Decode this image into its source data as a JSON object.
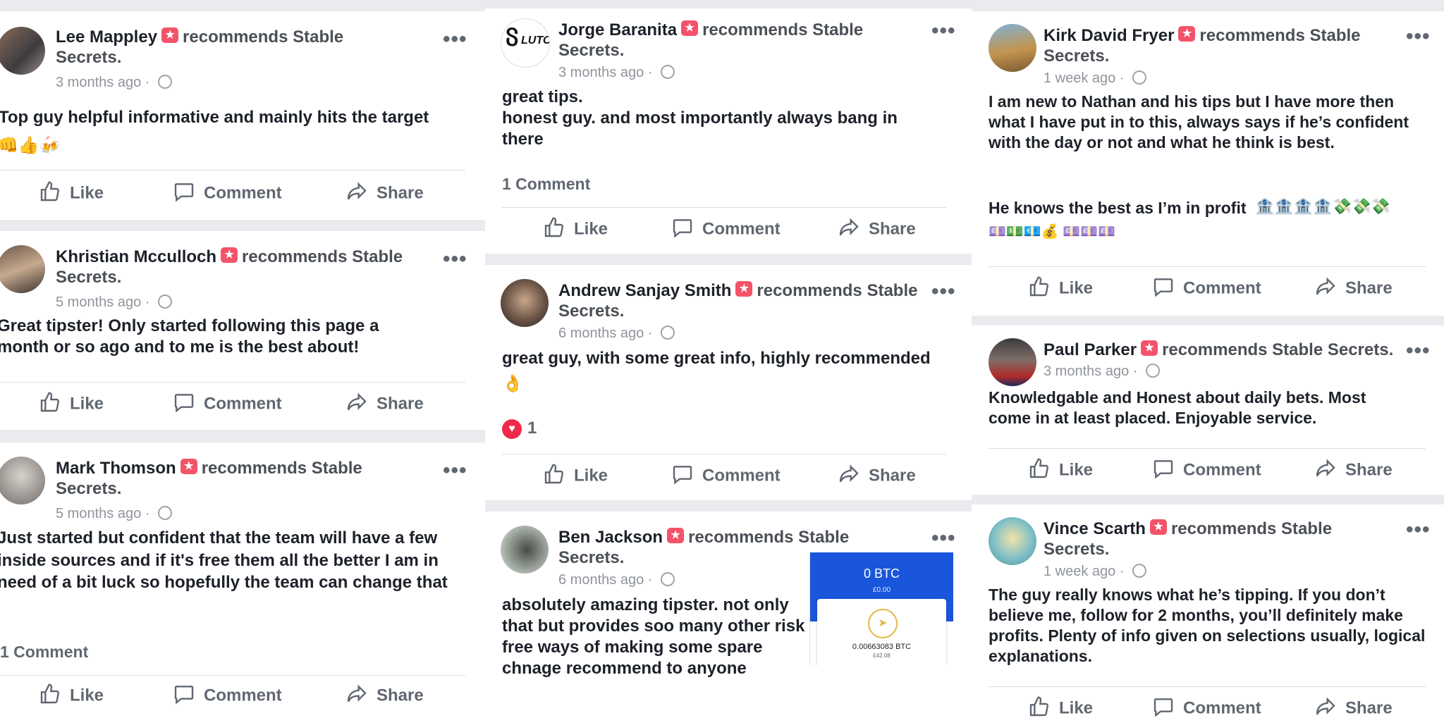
{
  "colors": {
    "background": "#e9ebee",
    "badge": "#f35369",
    "muted": "#90949c",
    "action": "#606770"
  },
  "recommend_suffix": "recommends Stable",
  "recommend_suffix_full": "recommends Stable Secrets.",
  "page_line2": "Secrets.",
  "actions": {
    "like": "Like",
    "comment": "Comment",
    "share": "Share"
  },
  "badge_icon": "star-icon",
  "columns": [
    {
      "reviews": [
        {
          "name": "Lee Mappley",
          "time": "3 months ago",
          "text": "Top guy helpful informative and mainly hits the target",
          "emoji": "👊👍🍻"
        },
        {
          "name": "Khristian Mcculloch",
          "time": "5 months ago",
          "text": "Great tipster! Only started following this page a month or so ago and to me is the best about!"
        },
        {
          "name": "Mark Thomson",
          "time": "5 months ago",
          "text": "Just started but confident that the team will have a few inside sources and if it's free them all the better I am in need of a bit luck so hopefully the team can change that",
          "comments": "1 Comment"
        }
      ]
    },
    {
      "reviews": [
        {
          "name": "Jorge Baranita",
          "time": "3 months ago",
          "text": "great tips.\nhonest guy. and most importantly always bang in there",
          "comments": "1 Comment",
          "avatar_text": "LUTO"
        },
        {
          "name": "Andrew Sanjay Smith",
          "time": "6 months ago",
          "text": "great guy, with some great info, highly recommended",
          "emoji": "👌",
          "reactions": "1"
        },
        {
          "name": "Ben Jackson",
          "time": "6 months ago",
          "text": "absolutely amazing tipster. not only that but provides soo many other risk free ways of making some spare chnage recommend to anyone",
          "attachment": {
            "balance": "0 BTC",
            "fiat": "£0.00",
            "amount": "0.00663083 BTC",
            "amount_fiat": "£42.08"
          }
        }
      ]
    },
    {
      "reviews": [
        {
          "name": "Kirk David Fryer",
          "time": "1 week ago",
          "text": "I am new to Nathan and his tips but I have more then what I have put in to this, always says if he’s confident with the day or not and what he think is best.",
          "text2": "He knows the best as I’m in profit",
          "emoji": "🏦🏦🏦🏦💸💸💸",
          "emoji2": "💷💵💶💰 💷💷💷"
        },
        {
          "name": "Paul Parker",
          "time": "3 months ago",
          "text": "Knowledgable and Honest about daily bets. Most come in at least placed.  Enjoyable service."
        },
        {
          "name": "Vince Scarth",
          "time": "1 week ago",
          "text": "The guy really knows what he’s tipping. If you don’t believe me, follow for 2 months, you’ll definitely make profits. Plenty of info given on selections usually, logical explanations."
        }
      ]
    }
  ]
}
